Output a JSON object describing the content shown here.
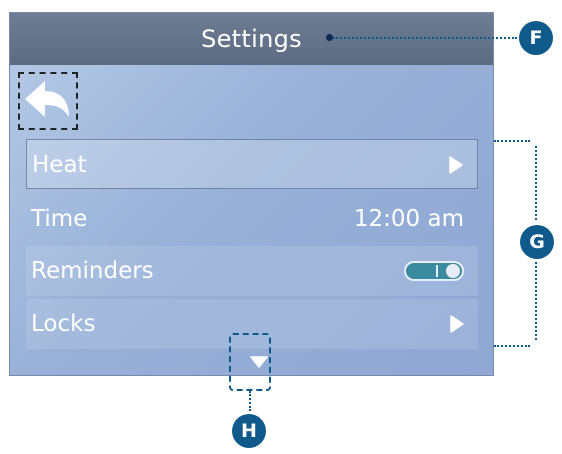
{
  "screen": {
    "title": "Settings",
    "colors": {
      "title_bar": "#5f6e86",
      "background": "#9db4da",
      "toggle_on": "#3a8aa0"
    },
    "back_icon": "back-arrow-icon",
    "rows": [
      {
        "label": "Heat",
        "type": "submenu",
        "icon": "chevron-right-icon",
        "selected": true
      },
      {
        "label": "Time",
        "type": "value",
        "value": "12:00 am"
      },
      {
        "label": "Reminders",
        "type": "toggle",
        "state": "on"
      },
      {
        "label": "Locks",
        "type": "submenu",
        "icon": "chevron-right-icon"
      }
    ],
    "scroll_icon": "chevron-down-icon"
  },
  "annotations": {
    "title_callout": "F",
    "list_callout": "G",
    "scroll_callout": "H",
    "color": "#0f5a8a"
  }
}
